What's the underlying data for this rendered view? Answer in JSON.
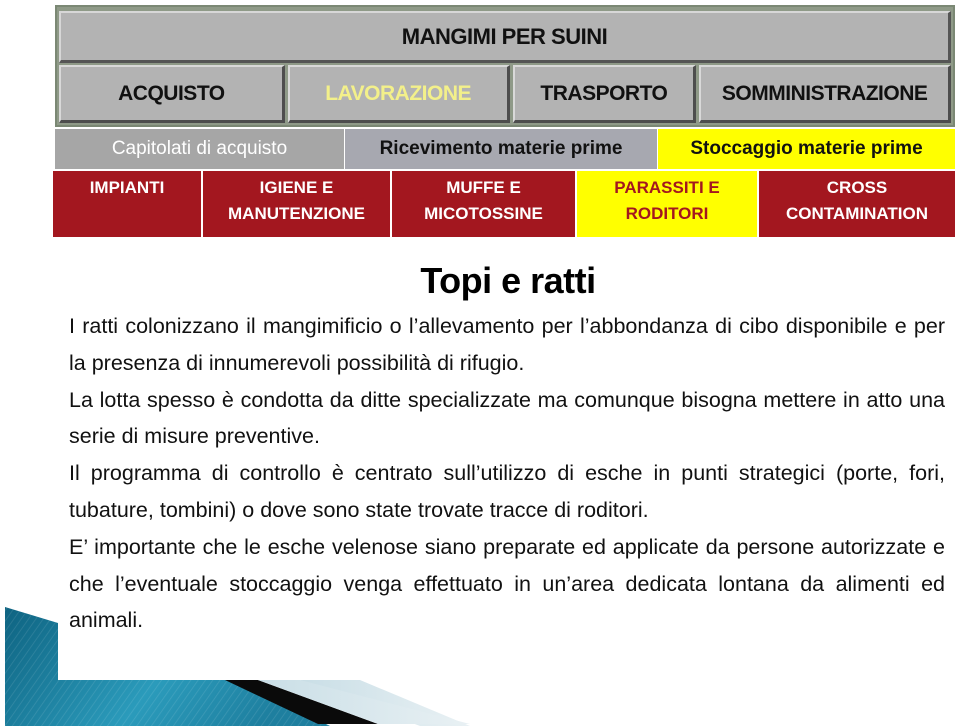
{
  "banner": {
    "title": "MANGIMI PER SUINI",
    "tabs": [
      {
        "label": "ACQUISTO",
        "active": false
      },
      {
        "label": "LAVORAZIONE",
        "active": true
      },
      {
        "label": "TRASPORTO",
        "active": false
      },
      {
        "label": "SOMMINISTRAZIONE",
        "active": false
      }
    ]
  },
  "subtabs": [
    {
      "label": "Capitolati di acquisto",
      "highlight": false
    },
    {
      "label": "Ricevimento materie prime",
      "highlight": false
    },
    {
      "label": "Stoccaggio materie prime",
      "highlight": true
    }
  ],
  "categories": [
    {
      "line1": "IMPIANTI",
      "line2": "",
      "highlight": false
    },
    {
      "line1": "IGIENE E",
      "line2": "MANUTENZIONE",
      "highlight": false
    },
    {
      "line1": "MUFFE E",
      "line2": "MICOTOSSINE",
      "highlight": false
    },
    {
      "line1": "PARASSITI E",
      "line2": "RODITORI",
      "highlight": true
    },
    {
      "line1": "CROSS",
      "line2": "CONTAMINATION",
      "highlight": false
    }
  ],
  "colors": {
    "banner_gray": "#b3b3b3",
    "active_tab_text": "#f3f08a",
    "highlight_yellow": "#ffff00",
    "category_red": "#a3171f",
    "deco_teal": "#1a7c9a"
  },
  "content": {
    "title": "Topi e ratti",
    "paragraphs": [
      "I ratti colonizzano il mangimificio o l’allevamento per l’abbondanza di cibo disponibile e per la presenza di innumerevoli possibilità di rifugio.",
      "La lotta spesso è condotta da ditte specializzate ma comunque bisogna mettere in atto una serie di misure preventive.",
      "Il programma di controllo è centrato sull’utilizzo di esche in punti strategici (porte, fori, tubature, tombini) o dove sono state trovate tracce di roditori.",
      "E’ importante che le esche velenose siano preparate ed applicate da persone autorizzate e che l’eventuale stoccaggio venga effettuato in un’area dedicata lontana da alimenti ed animali."
    ]
  }
}
